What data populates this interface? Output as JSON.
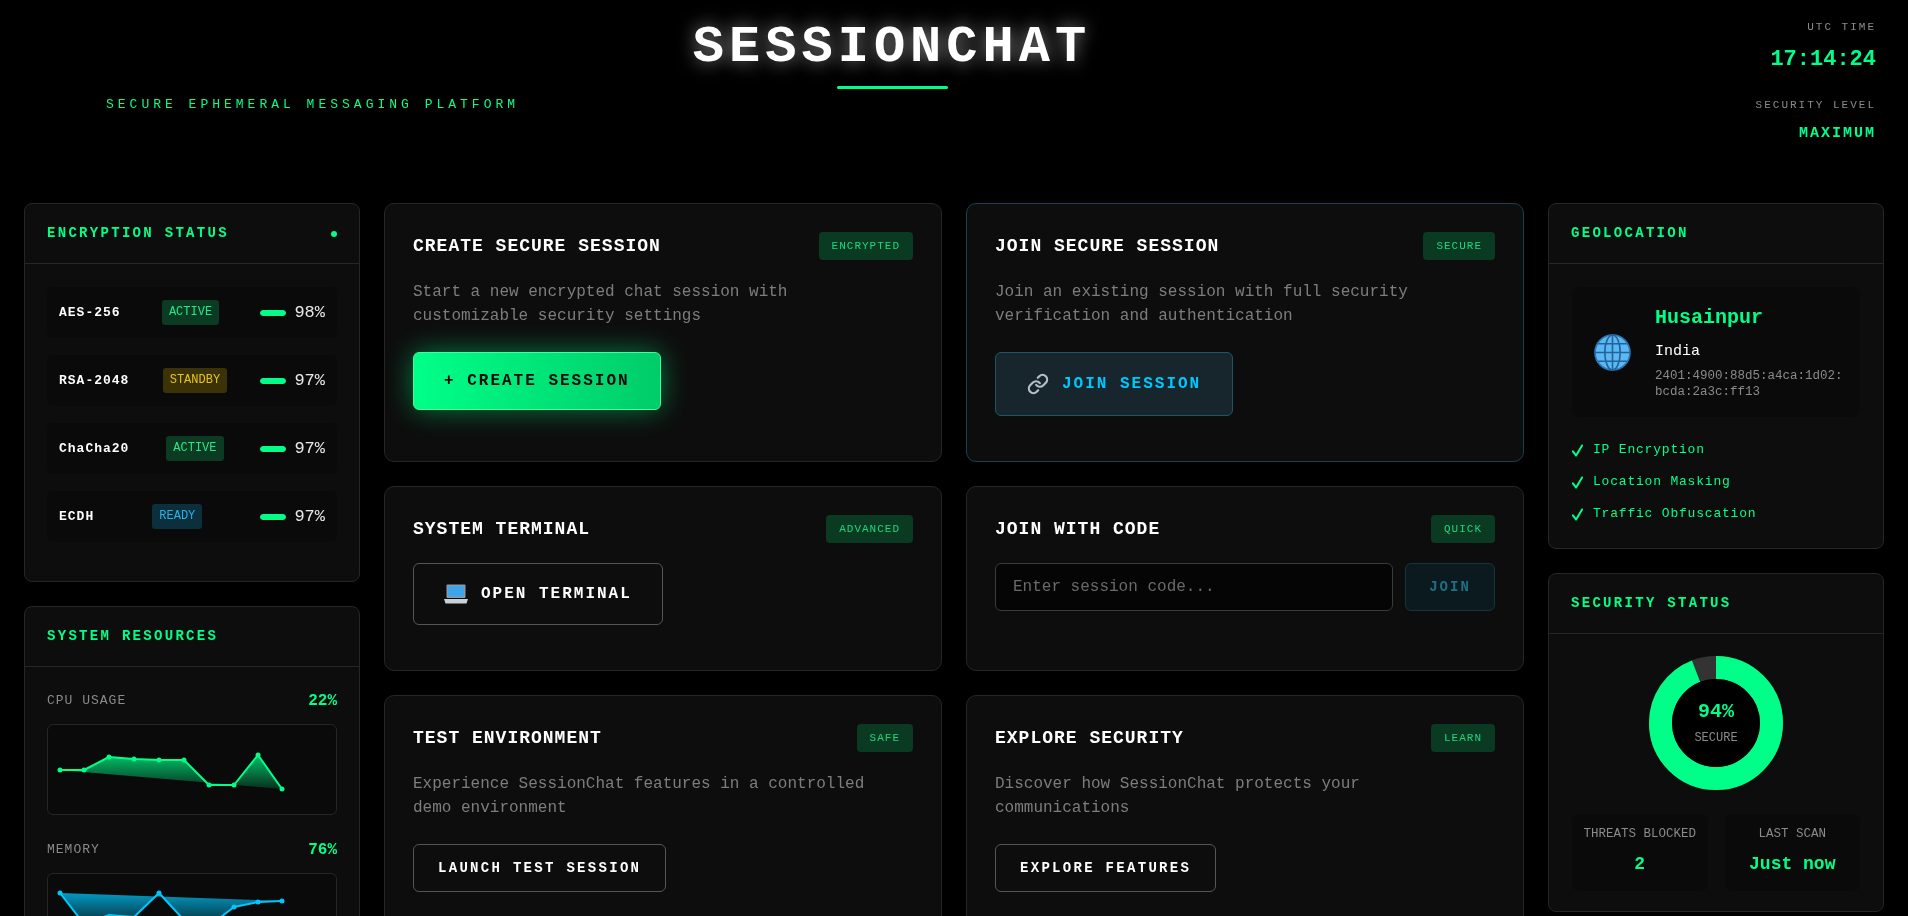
{
  "header": {
    "title": "SESSIONCHAT",
    "subtitle": "SECURE EPHEMERAL MESSAGING PLATFORM",
    "stats": [
      {
        "kind": "clock",
        "label": "UTC TIME",
        "value": "17:14:24"
      },
      {
        "kind": "level",
        "label": "SECURITY LEVEL",
        "value": "MAXIMUM"
      }
    ]
  },
  "encryption": {
    "title": "ENCRYPTION STATUS",
    "algorithms": [
      {
        "name": "AES-256",
        "status": "ACTIVE",
        "color": "#0b3b22",
        "level": 0.98,
        "reading": "98%"
      },
      {
        "name": "RSA-2048",
        "status": "STANDBY",
        "color": "#3b3208",
        "level": 0.97,
        "reading": "97%"
      },
      {
        "name": "ChaCha20",
        "status": "ACTIVE",
        "color": "#0b3b22",
        "level": 0.97,
        "reading": "97%"
      },
      {
        "name": "ECDH",
        "status": "READY",
        "color": "#0b2f3d",
        "level": 0.97,
        "reading": "97%"
      }
    ]
  },
  "resources": {
    "title": "SYSTEM RESOURCES",
    "metrics": [
      {
        "label": "CPU USAGE",
        "reading": "22%",
        "color": "#00ff88"
      },
      {
        "label": "MEMORY",
        "reading": "76%",
        "color": "#00c8ff"
      }
    ]
  },
  "cards": [
    {
      "title": "CREATE SECURE SESSION",
      "badge": "ENCRYPTED",
      "highlighted": false,
      "description": "Start a new encrypted chat session with customizable security settings",
      "action": {
        "kind": "primary",
        "label": "+ CREATE SESSION"
      }
    },
    {
      "title": "JOIN SECURE SESSION",
      "badge": "SECURE",
      "highlighted": true,
      "description": "Join an existing session with full security verification and authentication",
      "action": {
        "kind": "link",
        "label": "JOIN SESSION"
      }
    },
    {
      "title": "SYSTEM TERMINAL",
      "badge": "ADVANCED",
      "highlighted": false,
      "action": {
        "kind": "terminal",
        "label": "OPEN TERMINAL"
      }
    },
    {
      "title": "JOIN WITH CODE",
      "badge": "QUICK",
      "highlighted": false,
      "field": {
        "placeholder": "Enter session code..."
      },
      "action": {
        "kind": "join",
        "label": "JOIN",
        "disabled": true
      }
    },
    {
      "title": "TEST ENVIRONMENT",
      "badge": "SAFE",
      "highlighted": false,
      "description": "Experience SessionChat features in a controlled demo environment",
      "action": {
        "kind": "outline",
        "label": "LAUNCH TEST SESSION"
      }
    },
    {
      "title": "EXPLORE SECURITY",
      "badge": "LEARN",
      "highlighted": false,
      "description": "Discover how SessionChat protects your communications",
      "action": {
        "kind": "outline",
        "label": "EXPLORE FEATURES"
      }
    }
  ],
  "geolocation": {
    "title": "GEOLOCATION",
    "city": "Husainpur",
    "country": "India",
    "ip": "2401:4900:88d5:a4ca:1d02:bcda:2a3c:ff13",
    "features": [
      "IP Encryption",
      "Location Masking",
      "Traffic Obfuscation"
    ]
  },
  "security": {
    "title": "SECURITY STATUS",
    "level": 0.94,
    "reading": "94%",
    "caption": "SECURE",
    "stats": [
      {
        "label": "THREATS BLOCKED",
        "value": "2"
      },
      {
        "label": "LAST SCAN",
        "value": "Just now"
      }
    ]
  }
}
